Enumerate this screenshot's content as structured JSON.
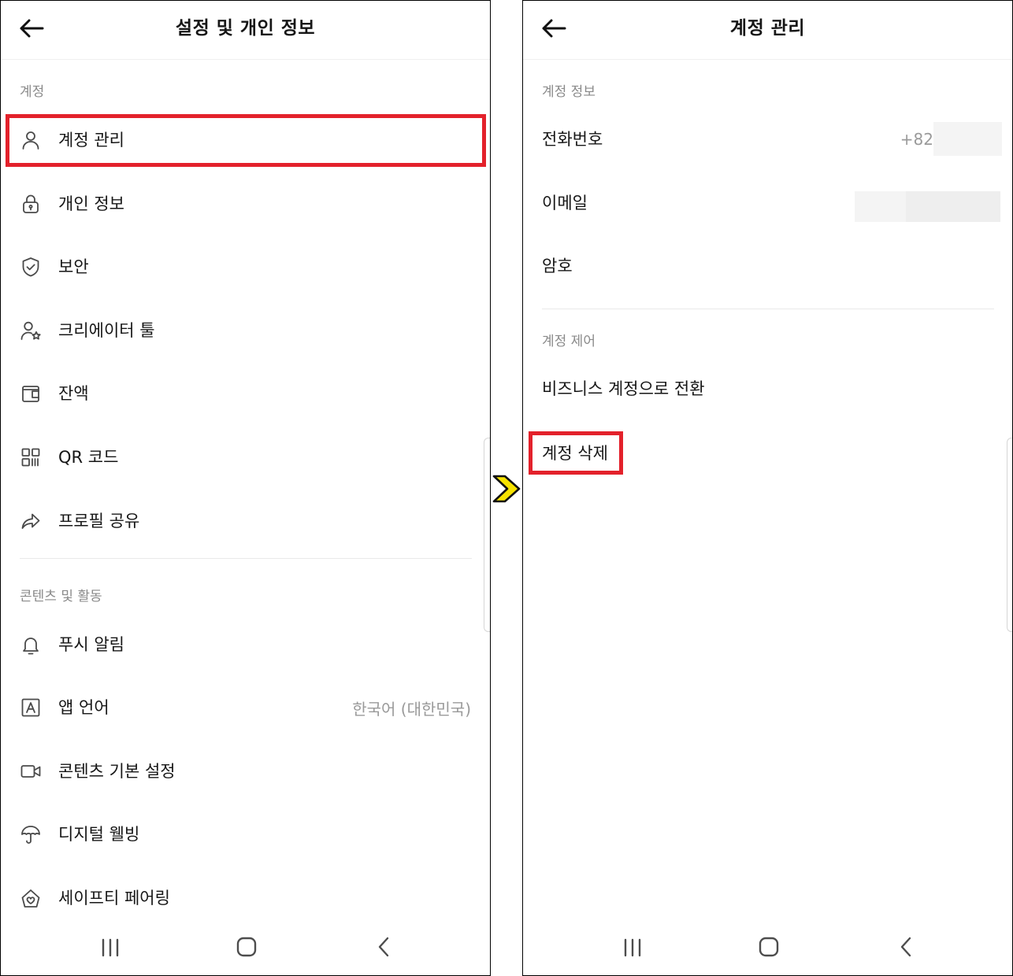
{
  "left_screen": {
    "header": {
      "title": "설정 및 개인 정보",
      "back_icon": "back-arrow-icon"
    },
    "section_account": {
      "label": "계정",
      "items": [
        {
          "label": "계정 관리",
          "icon": "person-icon",
          "highlighted": true
        },
        {
          "label": "개인 정보",
          "icon": "lock-icon"
        },
        {
          "label": "보안",
          "icon": "shield-check-icon"
        },
        {
          "label": "크리에이터 툴",
          "icon": "creator-star-icon"
        },
        {
          "label": "잔액",
          "icon": "wallet-icon"
        },
        {
          "label": "QR 코드",
          "icon": "qr-code-icon"
        },
        {
          "label": "프로필 공유",
          "icon": "share-arrow-icon"
        }
      ]
    },
    "section_content": {
      "label": "콘텐츠 및 활동",
      "items": [
        {
          "label": "푸시 알림",
          "icon": "bell-icon"
        },
        {
          "label": "앱 언어",
          "icon": "language-icon",
          "value": "한국어 (대한민국)"
        },
        {
          "label": "콘텐츠 기본 설정",
          "icon": "video-camera-icon"
        },
        {
          "label": "디지털 웰빙",
          "icon": "umbrella-icon"
        },
        {
          "label": "세이프티 페어링",
          "icon": "house-heart-icon"
        }
      ]
    },
    "nav_bar": {
      "icons": [
        "recent-apps-icon",
        "home-icon",
        "nav-back-icon"
      ]
    }
  },
  "right_screen": {
    "header": {
      "title": "계정 관리",
      "back_icon": "back-arrow-icon"
    },
    "section_info": {
      "label": "계정 정보",
      "items": [
        {
          "label": "전화번호",
          "value": "+82",
          "masked": true
        },
        {
          "label": "이메일",
          "masked": true
        },
        {
          "label": "암호"
        }
      ]
    },
    "section_control": {
      "label": "계정 제어",
      "items": [
        {
          "label": "비즈니스 계정으로 전환"
        },
        {
          "label": "계정 삭제",
          "highlighted": true
        }
      ]
    },
    "nav_bar": {
      "icons": [
        "recent-apps-icon",
        "home-icon",
        "nav-back-icon"
      ]
    }
  },
  "transition_arrow": {
    "icon": "yellow-chevron-right-icon",
    "color": "#f6e200"
  },
  "colors": {
    "highlight": "#e3212b",
    "text": "#161616",
    "secondary_text": "#8a8a8a",
    "value_text": "#9a9a9a",
    "divider": "#e9e9e9",
    "masked": "#f4f4f4"
  }
}
